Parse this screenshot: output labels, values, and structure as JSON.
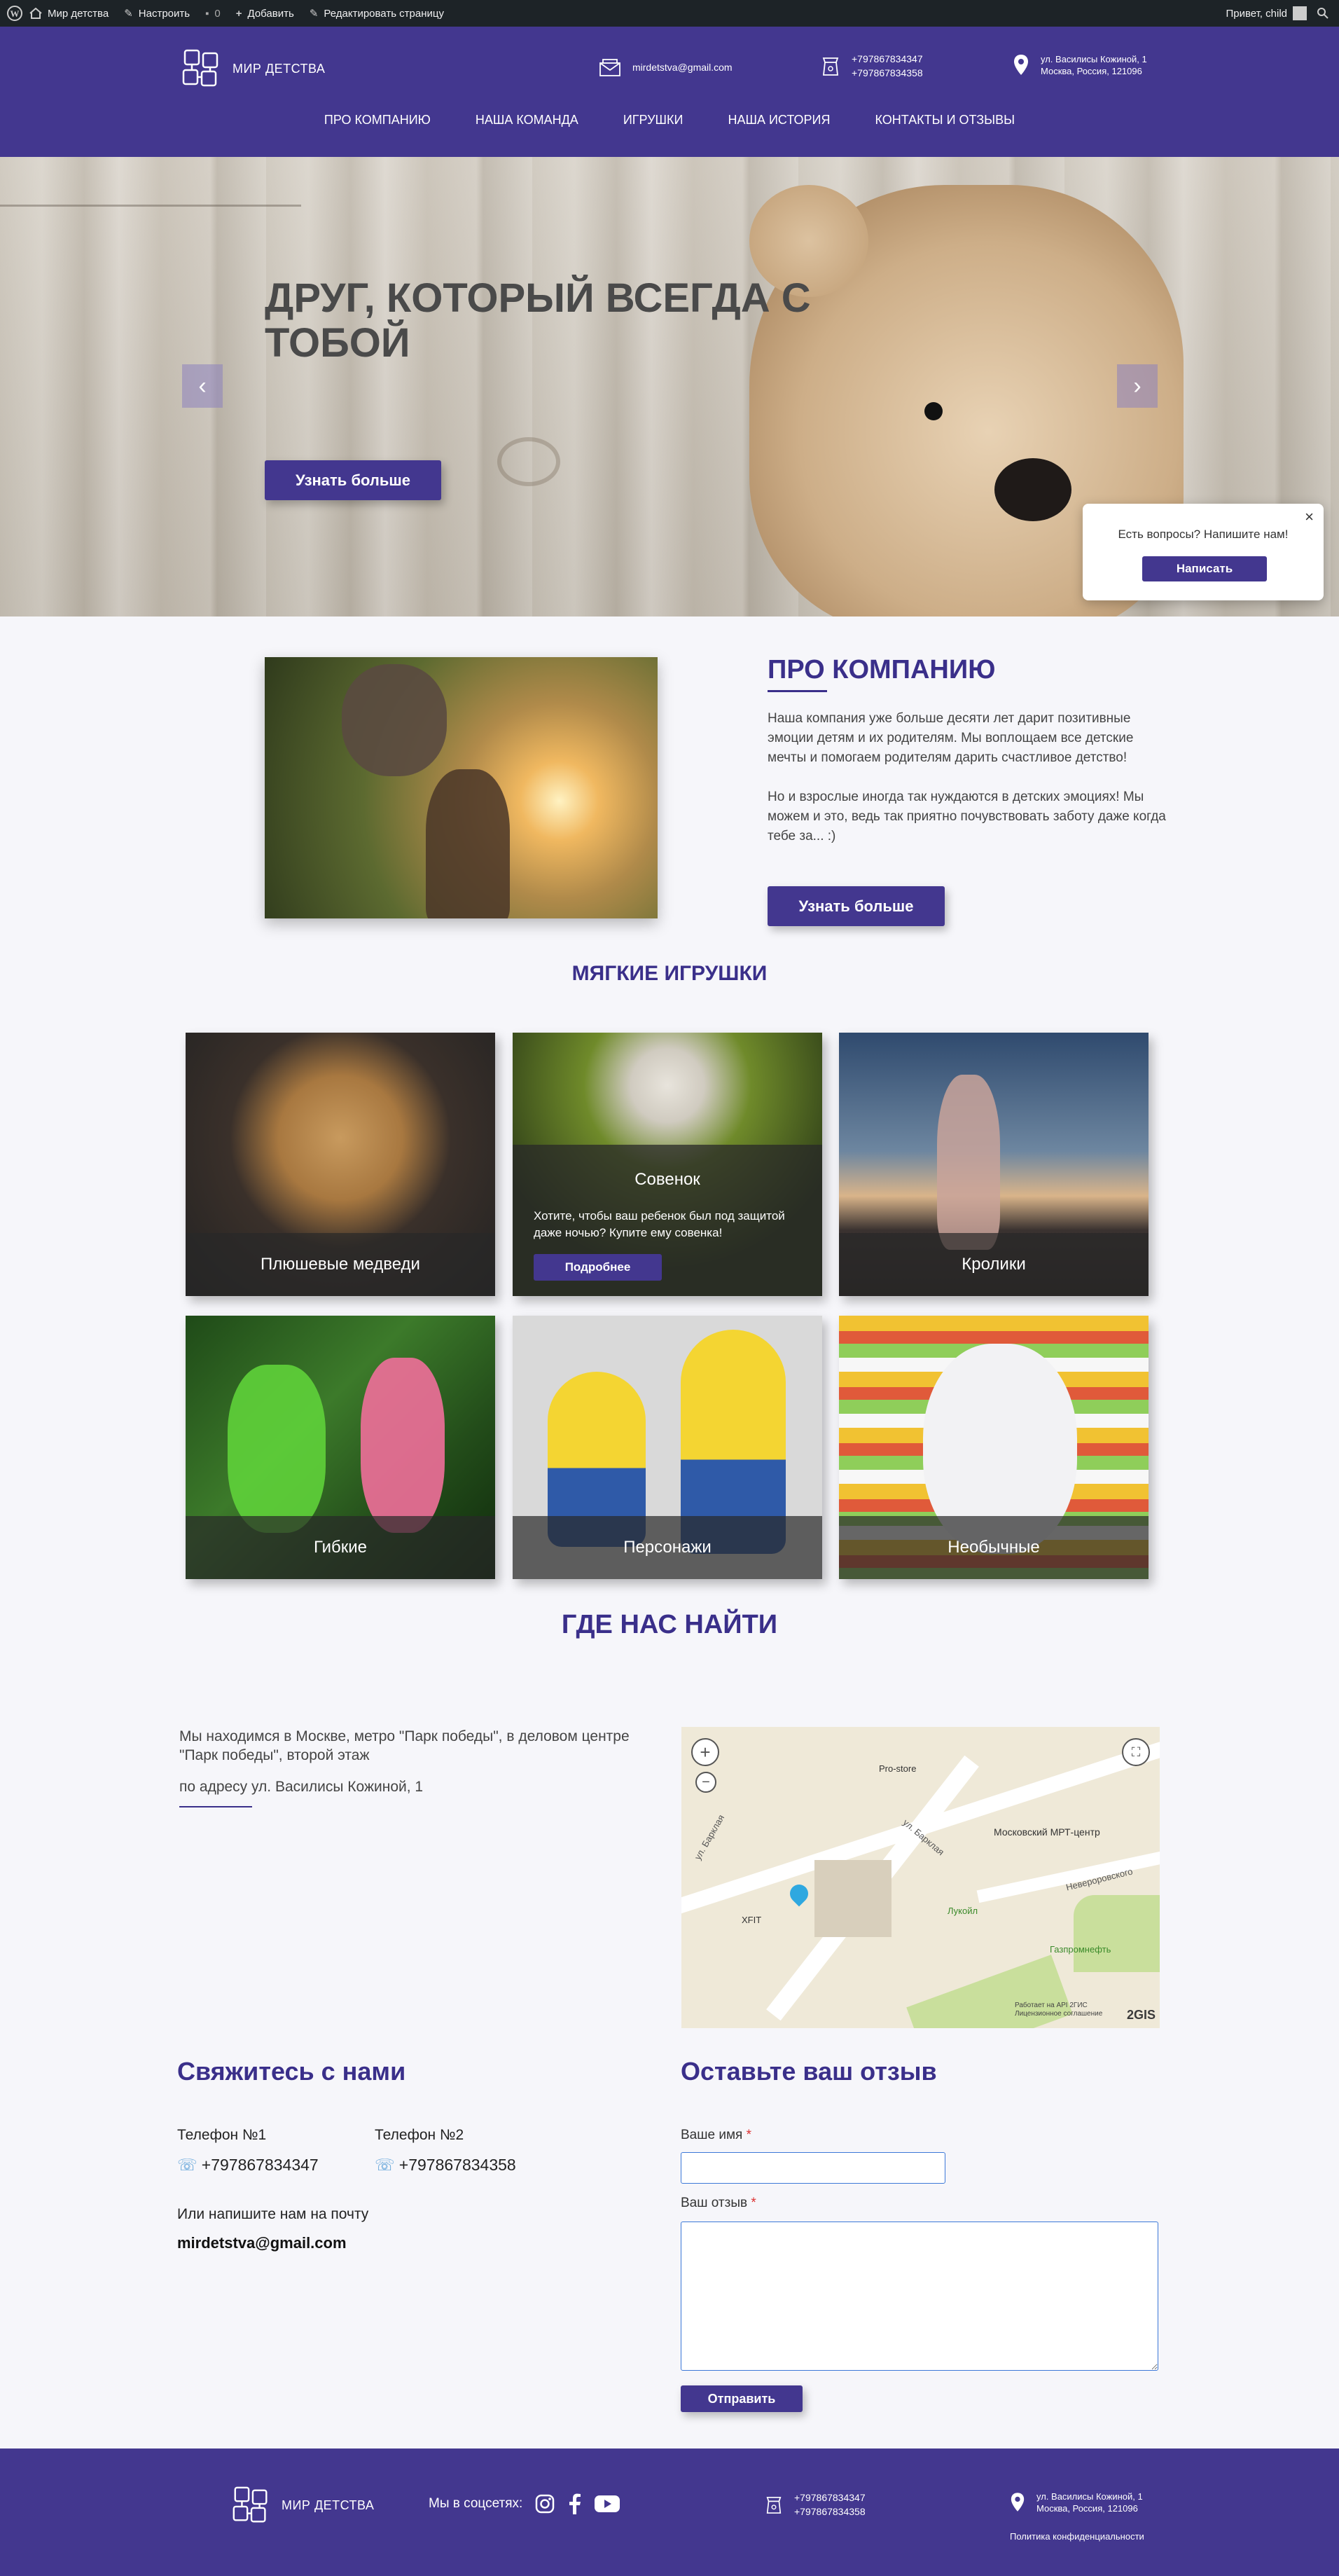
{
  "adminbar": {
    "site_name": "Мир детства",
    "customize": "Настроить",
    "comments": "0",
    "add_new": "Добавить",
    "edit_page": "Редактировать страницу",
    "greeting": "Привет, child"
  },
  "header": {
    "logo_text": "МИР ДЕТСТВА",
    "email": "mirdetstva@gmail.com",
    "phone1": "+797867834347",
    "phone2": "+797867834358",
    "address_line1": "ул. Василисы Кожиной, 1",
    "address_line2": "Москва, Россия, 121096",
    "nav": [
      "ПРО КОМПАНИЮ",
      "НАША КОМАНДА",
      "ИГРУШКИ",
      "НАША ИСТОРИЯ",
      "КОНТАКТЫ И ОТЗЫВЫ"
    ]
  },
  "hero": {
    "title": "ДРУГ, КОТОРЫЙ ВСЕГДА С ТОБОЙ",
    "button": "Узнать больше",
    "prev": "‹",
    "next": "›"
  },
  "chat_widget": {
    "question": "Есть вопросы? Напишите нам!",
    "button": "Написать",
    "close": "×"
  },
  "about": {
    "title": "ПРО КОМПАНИЮ",
    "paragraph1": "Наша компания уже больше десяти лет дарит позитивные эмоции детям и их родителям. Мы воплощаем все детские мечты и помогаем родителям дарить счастливое детство!",
    "paragraph2": "Но и взрослые иногда так нуждаются в детских эмоциях! Мы можем и это, ведь так приятно почувствовать заботу даже когда тебе за... :)",
    "button": "Узнать больше"
  },
  "toys": {
    "title": "МЯГКИЕ ИГРУШКИ",
    "items": [
      {
        "label": "Плюшевые медведи"
      },
      {
        "label": "Совенок",
        "desc": "Хотите, чтобы ваш ребенок был под защитой даже ночью? Купите ему совенка!",
        "button": "Подробнее"
      },
      {
        "label": "Кролики"
      },
      {
        "label": "Гибкие"
      },
      {
        "label": "Персонажи"
      },
      {
        "label": "Необычные"
      }
    ]
  },
  "location": {
    "title": "ГДЕ НАС НАЙТИ",
    "text": "Мы находимся в Москве, метро \"Парк победы\", в деловом центре \"Парк победы\", второй этаж",
    "address": "по адресу ул. Василисы Кожиной, 1",
    "map": {
      "zoom_in": "+",
      "zoom_out": "−",
      "labels": [
        "Pro-store",
        "Московский МРТ-центр",
        "Лукойл",
        "Газпромнефть",
        "XFIT",
        "Невероровского",
        "ул. Барклая",
        "ул. Барклая"
      ],
      "attribution1": "Работает на API 2ГИС",
      "attribution2": "Лицензионное соглашение",
      "brand": "2GIS"
    }
  },
  "contacts": {
    "title": "Свяжитесь с нами",
    "phone1_label": "Телефон №1",
    "phone1": "+797867834347",
    "phone2_label": "Телефон №2",
    "phone2": "+797867834358",
    "email_label": "Или напишите нам на почту",
    "email": "mirdetstva@gmail.com"
  },
  "review_form": {
    "title": "Оставьте ваш отзыв",
    "name_label": "Ваше имя",
    "review_label": "Ваш отзыв",
    "required": "*",
    "submit": "Отправить"
  },
  "footer": {
    "logo_text": "МИР ДЕТСТВА",
    "social_label": "Мы в соцсетях:",
    "phone1": "+797867834347",
    "phone2": "+797867834358",
    "address_line1": "ул. Василисы Кожиной, 1",
    "address_line2": "Москва, Россия, 121096",
    "privacy": "Политика конфиденциальности"
  },
  "colors": {
    "brand": "#43378f",
    "adminbar": "#1d2327",
    "page_bg": "#f6f6fa"
  },
  "icons": [
    "wordpress-icon",
    "brush-icon",
    "comment-icon",
    "plus-icon",
    "pencil-icon",
    "search-icon",
    "envelope-icon",
    "phone-icon",
    "location-pin-icon",
    "instagram-icon",
    "facebook-icon",
    "youtube-icon",
    "fullscreen-icon"
  ]
}
